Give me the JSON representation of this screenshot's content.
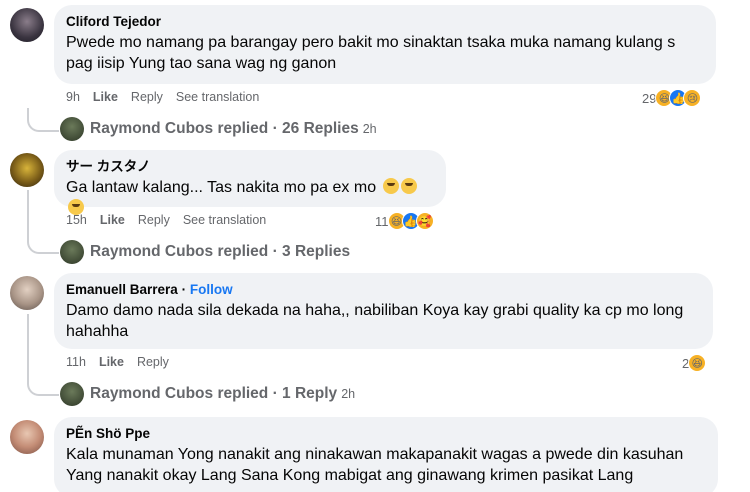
{
  "comments": [
    {
      "name": "Cliford Tejedor",
      "text": "Pwede mo namang pa barangay pero bakit mo sinaktan tsaka muka namang kulang s pag iisip Yung tao sana wag ng ganon",
      "time": "9h",
      "like": "Like",
      "reply": "Reply",
      "translation": "See translation",
      "reaction_count": "29",
      "replies": "Raymond Cubos replied · 26 Replies",
      "replies_time": "2h"
    },
    {
      "name": "サー カスタノ",
      "text": "Ga lantaw kalang... Tas nakita mo pa ex mo",
      "time": "15h",
      "like": "Like",
      "reply": "Reply",
      "translation": "See translation",
      "reaction_count": "11",
      "replies": "Raymond Cubos replied · 3 Replies",
      "replies_time": ""
    },
    {
      "name": "Emanuell Barrera",
      "follow": "Follow",
      "separator": "·",
      "text": "Damo damo nada sila dekada na haha,, nabiliban Koya kay grabi quality ka cp mo long hahahha",
      "time": "11h",
      "like": "Like",
      "reply": "Reply",
      "reaction_count": "2",
      "replies": "Raymond Cubos replied · 1 Reply",
      "replies_time": "2h"
    },
    {
      "name": "PẼn Shö Ppe",
      "text": "Kala munaman Yong nanakit ang ninakawan makapanakit wagas a pwede din kasuhan Yang nanakit okay Lang Sana Kong mabigat ang ginawang krimen pasikat Lang"
    }
  ],
  "icons": {
    "haha": "haha-reaction-icon",
    "like": "like-reaction-icon",
    "sad": "sad-reaction-icon",
    "care": "care-reaction-icon"
  },
  "colors": {
    "bubble": "#f0f2f5",
    "secondary_text": "#65676b",
    "link": "#1877f2"
  }
}
